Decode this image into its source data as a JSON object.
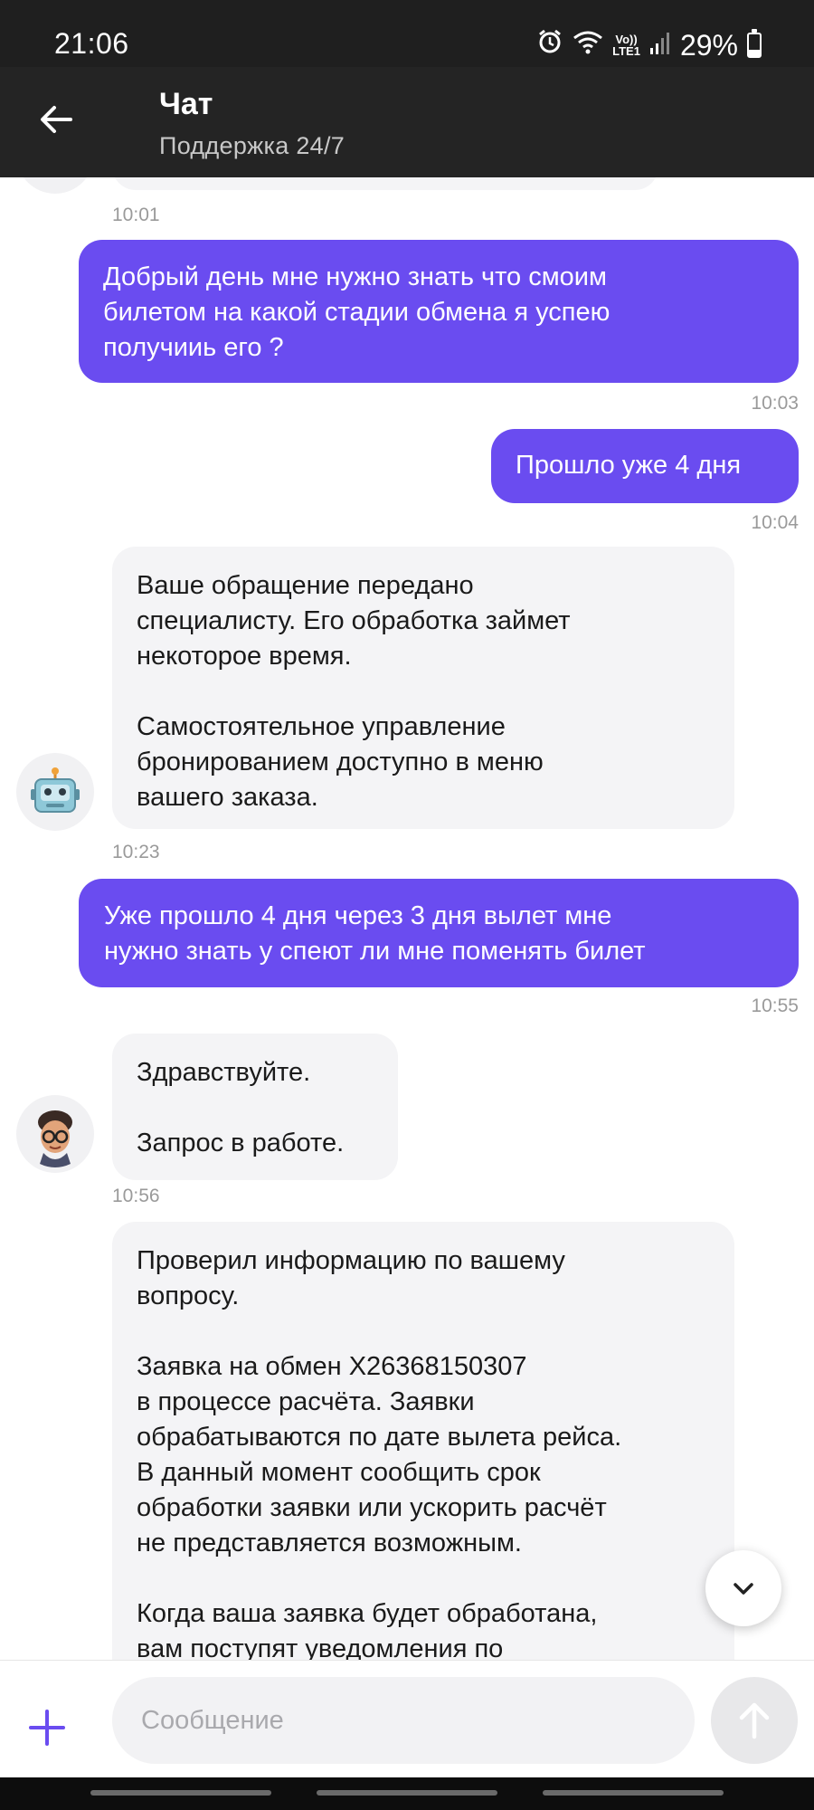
{
  "status_bar": {
    "time": "21:06",
    "alarm_icon": "alarm-icon",
    "wifi_icon": "wifi-icon",
    "volte_line1": "Vo))",
    "volte_line2": "LTE1",
    "signal_icon": "signal-icon",
    "battery": "29%",
    "battery_level": 0.29
  },
  "header": {
    "back_icon": "arrow-left-icon",
    "title": "Чат",
    "subtitle": "Поддержка 24/7"
  },
  "messages": [
    {
      "direction": "time",
      "time": "10:01"
    },
    {
      "direction": "outgoing",
      "text": "Добрый день мне нужно знать что смоим\nбилетом на какой стадии обмена  я успею\nполучииь его ?",
      "time": "10:03"
    },
    {
      "direction": "outgoing",
      "text": "Прошло уже 4 дня",
      "time": "10:04"
    },
    {
      "direction": "incoming",
      "avatar": "robot-avatar-icon",
      "text": "Ваше обращение передано\nспециалисту. Его обработка займет\nнекоторое время.\n\nСамостоятельное управление\nбронированием доступно в меню\nвашего заказа.",
      "time": "10:23"
    },
    {
      "direction": "outgoing",
      "text": "Уже прошло 4 дня через 3 дня вылет мне\nнужно знать у спеют ли мне поменять билет",
      "time": "10:55"
    },
    {
      "direction": "incoming",
      "avatar": "agent-avatar-icon",
      "text": "Здравствуйте.\n\nЗапрос в работе.",
      "time": "10:56"
    },
    {
      "direction": "incoming",
      "text": "Проверил информацию по вашему\nвопросу.\n\nЗаявка на обмен X26368150307\nв процессе расчёта. Заявки\nобрабатываются по дате вылета рейса.\nВ данный момент сообщить срок\nобработки заявки или ускорить расчёт\nне представляется возможным.\n\nКогда ваша заявка будет обработана,\nвам поступят уведомления по"
    }
  ],
  "scroll_button_icon": "chevron-down-icon",
  "composer": {
    "plus_icon": "plus-icon",
    "placeholder": "Сообщение",
    "value": "",
    "send_icon": "arrow-up-icon"
  },
  "colors": {
    "accent": "#6a4cf0",
    "incoming_bubble": "#f4f4f6",
    "header_bg": "#242424",
    "plus_icon": "#6a4cf0"
  }
}
